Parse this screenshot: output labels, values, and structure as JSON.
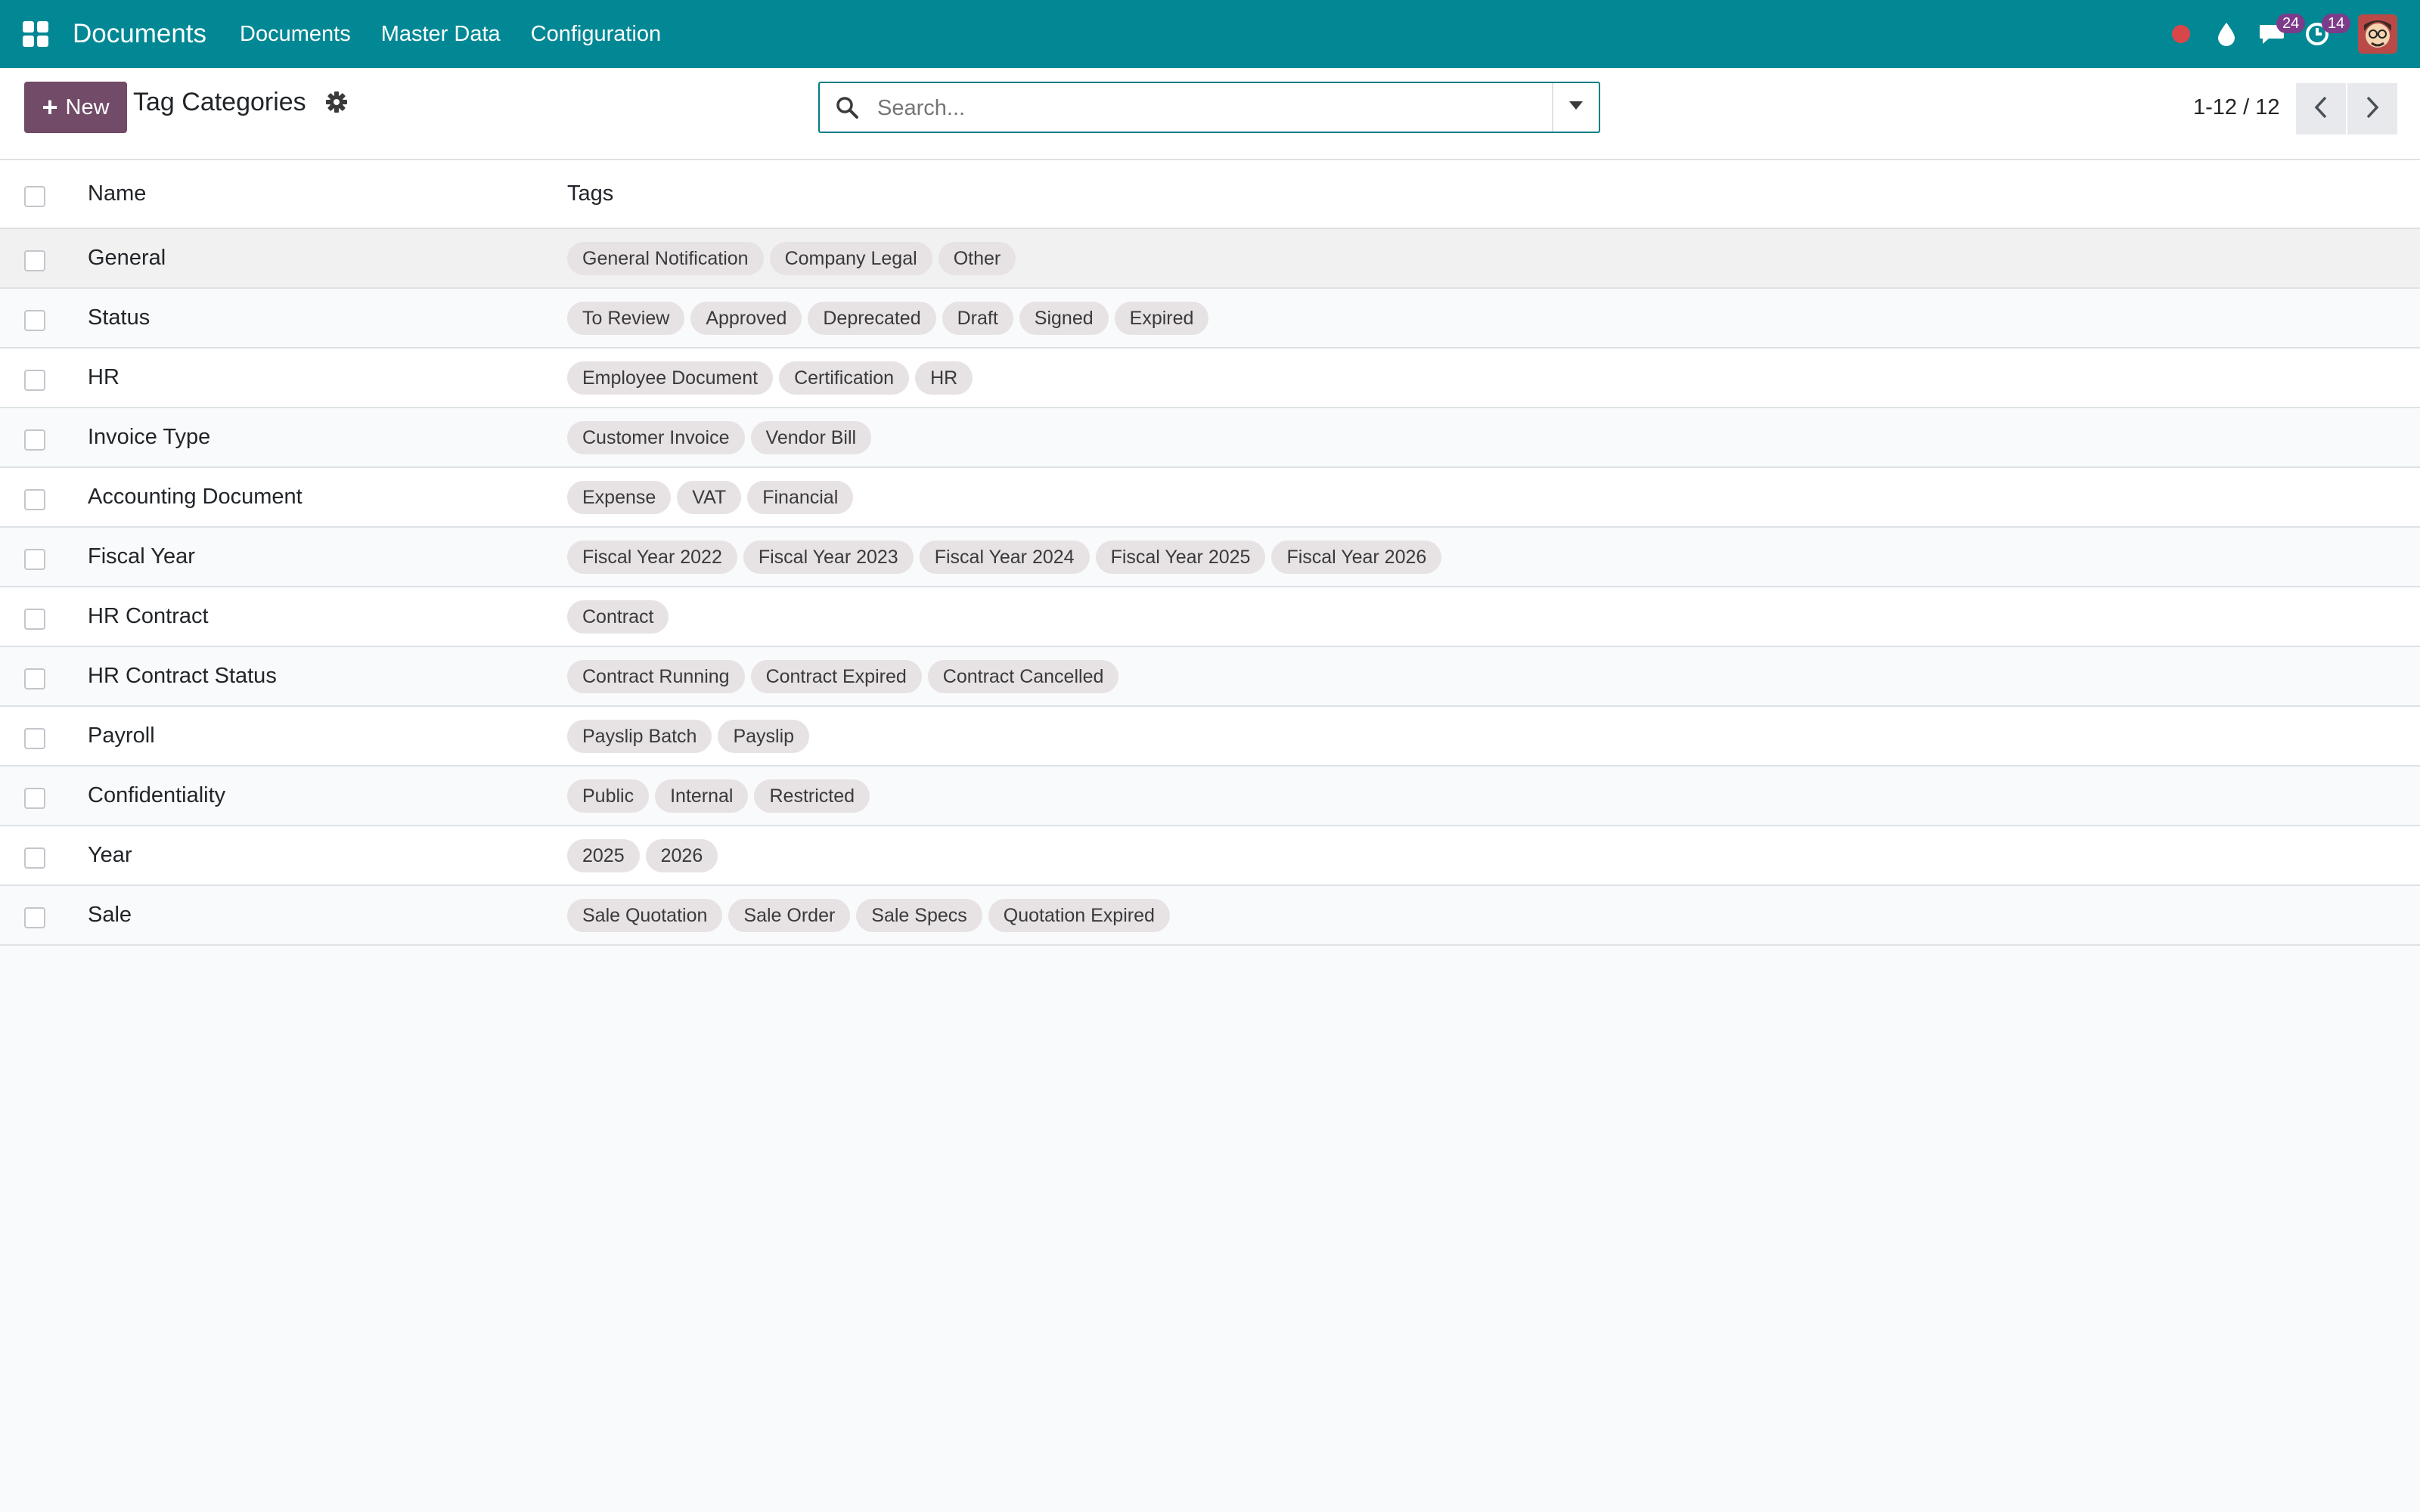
{
  "navbar": {
    "brand": "Documents",
    "menu": [
      "Documents",
      "Master Data",
      "Configuration"
    ],
    "messages_count": "24",
    "activities_count": "14"
  },
  "control_panel": {
    "new_label": "New",
    "title": "Tag Categories",
    "search_placeholder": "Search...",
    "pager": "1-12 / 12"
  },
  "table": {
    "headers": {
      "name": "Name",
      "tags": "Tags"
    },
    "rows": [
      {
        "name": "General",
        "tags": [
          "General Notification",
          "Company Legal",
          "Other"
        ]
      },
      {
        "name": "Status",
        "tags": [
          "To Review",
          "Approved",
          "Deprecated",
          "Draft",
          "Signed",
          "Expired"
        ]
      },
      {
        "name": "HR",
        "tags": [
          "Employee Document",
          "Certification",
          "HR"
        ]
      },
      {
        "name": "Invoice Type",
        "tags": [
          "Customer Invoice",
          "Vendor Bill"
        ]
      },
      {
        "name": "Accounting Document",
        "tags": [
          "Expense",
          "VAT",
          "Financial"
        ]
      },
      {
        "name": "Fiscal Year",
        "tags": [
          "Fiscal Year 2022",
          "Fiscal Year 2023",
          "Fiscal Year 2024",
          "Fiscal Year 2025",
          "Fiscal Year 2026"
        ]
      },
      {
        "name": "HR Contract",
        "tags": [
          "Contract"
        ]
      },
      {
        "name": "HR Contract Status",
        "tags": [
          "Contract Running",
          "Contract Expired",
          "Contract Cancelled"
        ]
      },
      {
        "name": "Payroll",
        "tags": [
          "Payslip Batch",
          "Payslip"
        ]
      },
      {
        "name": "Confidentiality",
        "tags": [
          "Public",
          "Internal",
          "Restricted"
        ]
      },
      {
        "name": "Year",
        "tags": [
          "2025",
          "2026"
        ]
      },
      {
        "name": "Sale",
        "tags": [
          "Sale Quotation",
          "Sale Order",
          "Sale Specs",
          "Quotation Expired"
        ]
      }
    ]
  },
  "colors": {
    "navbar": "#018894",
    "primary_button": "#714b67",
    "tag_bg": "#e7e2e3",
    "badge": "#7c3c8a",
    "recording_dot": "#d9464a"
  },
  "icons": {
    "apps": "apps-grid-icon",
    "record": "record-dot-icon",
    "drop": "water-drop-icon",
    "messages": "chat-bubble-icon",
    "activities": "clock-icon",
    "gear": "gear-icon",
    "search": "search-icon",
    "caret": "caret-down-icon",
    "prev": "chevron-left-icon",
    "next": "chevron-right-icon"
  }
}
